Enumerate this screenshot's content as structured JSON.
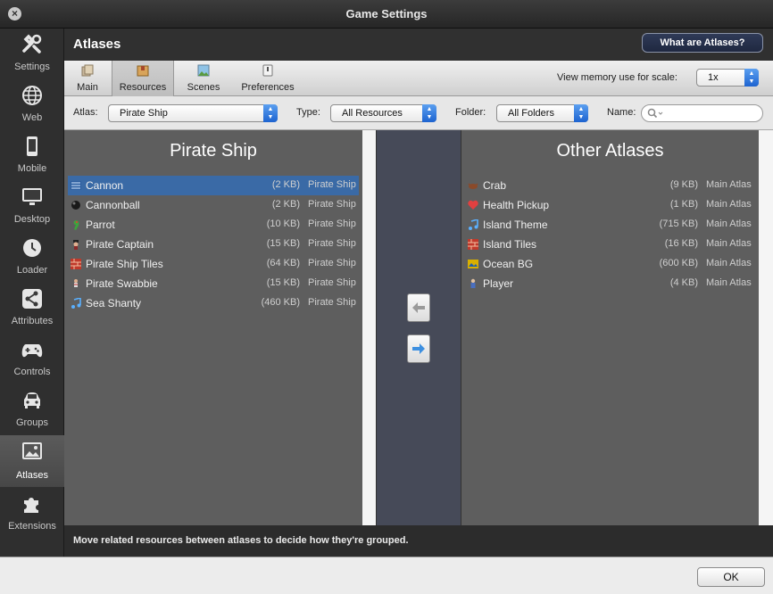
{
  "window": {
    "title": "Game Settings"
  },
  "sidebar": {
    "items": [
      {
        "label": "Settings",
        "icon": "tools-icon"
      },
      {
        "label": "Web",
        "icon": "globe-icon"
      },
      {
        "label": "Mobile",
        "icon": "mobile-icon"
      },
      {
        "label": "Desktop",
        "icon": "monitor-icon"
      },
      {
        "label": "Loader",
        "icon": "clock-icon"
      },
      {
        "label": "Attributes",
        "icon": "share-icon"
      },
      {
        "label": "Controls",
        "icon": "gamepad-icon"
      },
      {
        "label": "Groups",
        "icon": "car-icon"
      },
      {
        "label": "Atlases",
        "icon": "image-icon"
      },
      {
        "label": "Extensions",
        "icon": "puzzle-icon"
      }
    ],
    "active": "Atlases"
  },
  "header": {
    "title": "Atlases",
    "help_button": "What are Atlases?"
  },
  "toolbar": {
    "tabs": [
      {
        "label": "Main"
      },
      {
        "label": "Resources"
      },
      {
        "label": "Scenes"
      },
      {
        "label": "Preferences"
      }
    ],
    "active": "Resources",
    "memory_label": "View memory use for scale:",
    "memory_value": "1x"
  },
  "filters": {
    "atlas_label": "Atlas:",
    "atlas_value": "Pirate Ship",
    "type_label": "Type:",
    "type_value": "All Resources",
    "folder_label": "Folder:",
    "folder_value": "All Folders",
    "name_label": "Name:",
    "name_value": ""
  },
  "left": {
    "title": "Pirate Ship",
    "items": [
      {
        "name": "Cannon",
        "size": "(2 KB)",
        "atlas": "Pirate Ship",
        "selected": true,
        "icon": "flag-icon"
      },
      {
        "name": "Cannonball",
        "size": "(2 KB)",
        "atlas": "Pirate Ship",
        "icon": "ball-icon"
      },
      {
        "name": "Parrot",
        "size": "(10 KB)",
        "atlas": "Pirate Ship",
        "icon": "parrot-icon"
      },
      {
        "name": "Pirate Captain",
        "size": "(15 KB)",
        "atlas": "Pirate Ship",
        "icon": "pirate-icon"
      },
      {
        "name": "Pirate Ship Tiles",
        "size": "(64 KB)",
        "atlas": "Pirate Ship",
        "icon": "tiles-icon"
      },
      {
        "name": "Pirate Swabbie",
        "size": "(15 KB)",
        "atlas": "Pirate Ship",
        "icon": "swabbie-icon"
      },
      {
        "name": "Sea Shanty",
        "size": "(460 KB)",
        "atlas": "Pirate Ship",
        "icon": "music-note-icon"
      }
    ]
  },
  "right": {
    "title": "Other Atlases",
    "items": [
      {
        "name": "Crab",
        "size": "(9 KB)",
        "atlas": "Main Atlas",
        "icon": "crab-icon"
      },
      {
        "name": "Health Pickup",
        "size": "(1 KB)",
        "atlas": "Main Atlas",
        "icon": "heart-icon"
      },
      {
        "name": "Island Theme",
        "size": "(715 KB)",
        "atlas": "Main Atlas",
        "icon": "music-note-icon"
      },
      {
        "name": "Island Tiles",
        "size": "(16 KB)",
        "atlas": "Main Atlas",
        "icon": "tiles-icon"
      },
      {
        "name": "Ocean BG",
        "size": "(600 KB)",
        "atlas": "Main Atlas",
        "icon": "picture-icon"
      },
      {
        "name": "Player",
        "size": "(4 KB)",
        "atlas": "Main Atlas",
        "icon": "player-icon"
      }
    ]
  },
  "status": "Move related resources between atlases to decide how they're grouped.",
  "footer": {
    "ok_label": "OK"
  }
}
